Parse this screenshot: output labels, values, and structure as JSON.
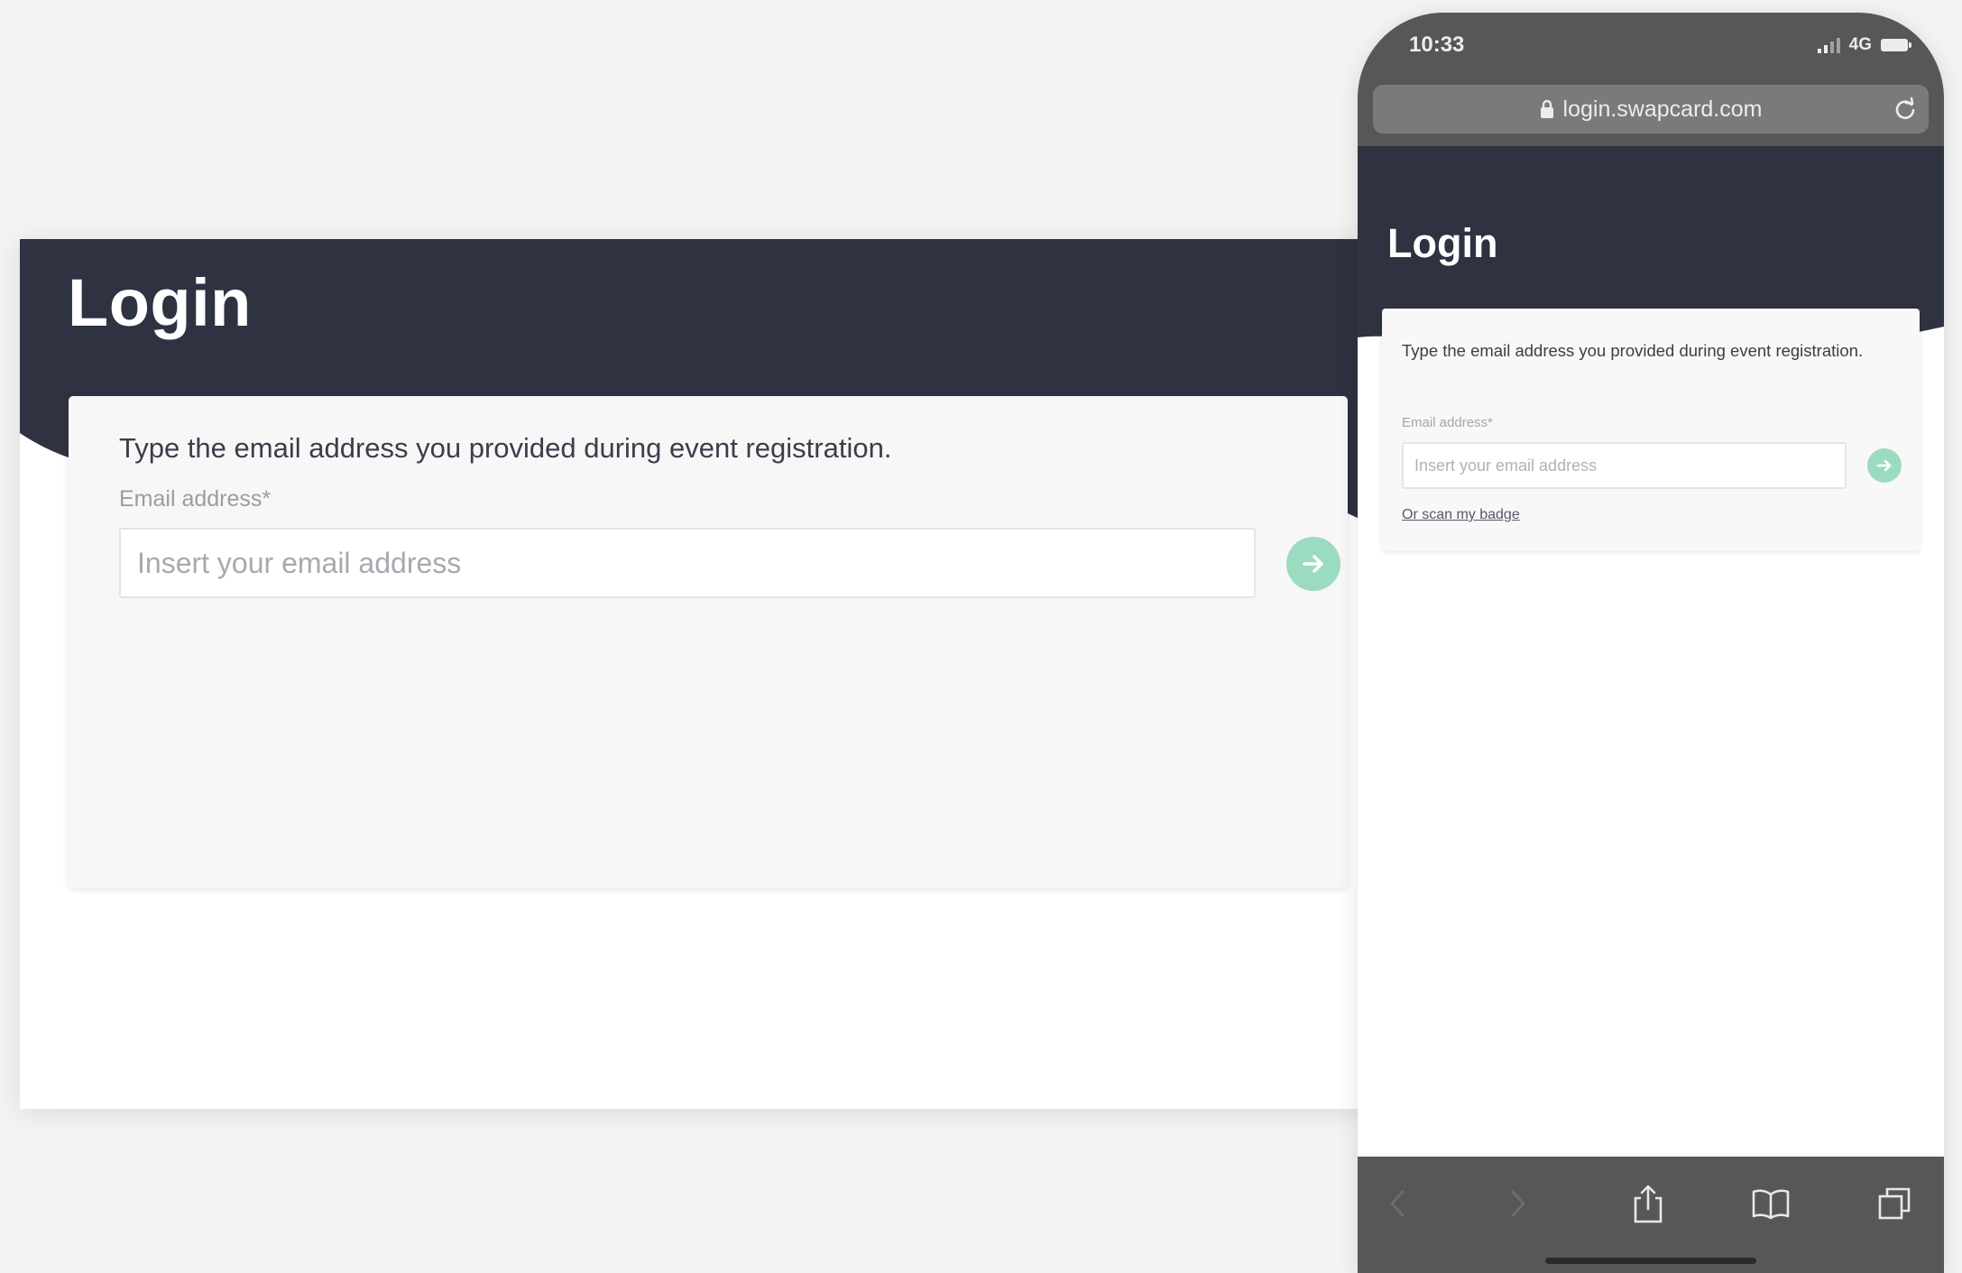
{
  "desktop": {
    "title": "Login",
    "instruction": "Type the email address you provided during event registration.",
    "email_label": "Email address*",
    "email_placeholder": "Insert your email address",
    "email_value": "",
    "submit_icon": "arrow-right-icon"
  },
  "phone": {
    "status_bar": {
      "time": "10:33",
      "network": "4G"
    },
    "address_bar": {
      "url": "login.swapcard.com"
    },
    "title": "Login",
    "instruction": "Type the email address you provided during event registration.",
    "email_label": "Email address*",
    "email_placeholder": "Insert your email address",
    "email_value": "",
    "scan_badge_link": "Or scan my badge",
    "toolbar_icons": [
      "back-icon",
      "forward-icon",
      "share-icon",
      "bookmarks-icon",
      "tabs-icon"
    ]
  },
  "colors": {
    "header_bg": "#2e3241",
    "accent_green": "#9bdcc0",
    "page_bg": "#f3f3f3",
    "phone_frame": "#575757"
  }
}
